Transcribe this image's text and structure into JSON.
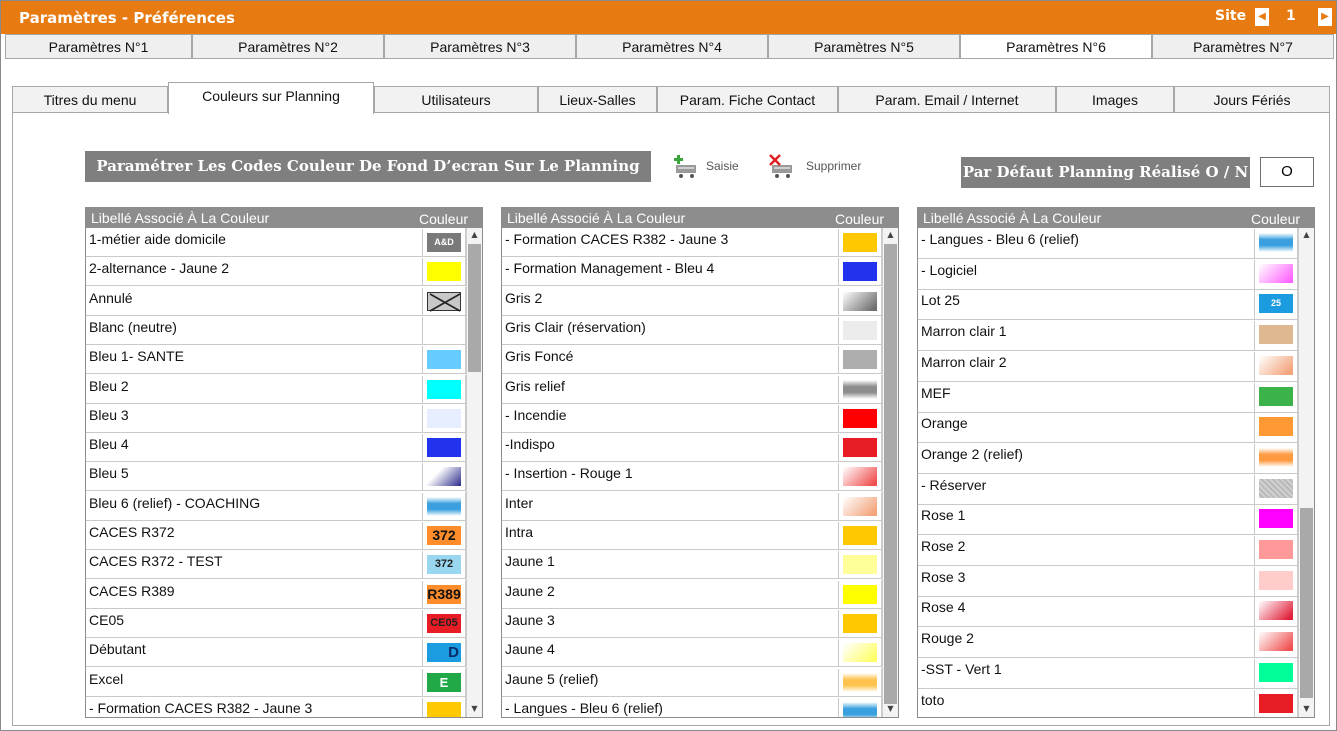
{
  "title": "Paramètres - Préférences",
  "site": {
    "label": "Site",
    "value": "1",
    "prev": "◀",
    "next": "▶"
  },
  "main_tabs": [
    "Paramètres N°1",
    "Paramètres N°2",
    "Paramètres N°3",
    "Paramètres N°4",
    "Paramètres N°5",
    "Paramètres N°6",
    "Paramètres N°7"
  ],
  "main_tab_active": 5,
  "sub_tabs": [
    "Titres du menu",
    "Couleurs sur Planning",
    "Utilisateurs",
    "Lieux-Salles",
    "Param. Fiche Contact",
    "Param. Email / Internet",
    "Images",
    "Jours Fériés"
  ],
  "sub_tab_active": 1,
  "header_button": "Paramétrer Les Codes Couleur De Fond D’ecran Sur Le Planning",
  "actions": {
    "saisie": "Saisie",
    "supprimer": "Supprimer"
  },
  "default_label": "Par Défaut Planning Réalisé O / N",
  "default_value": "O",
  "list_header": {
    "label": "Libellé Associé À La Couleur",
    "color": "Couleur"
  },
  "lists": [
    [
      {
        "label": "1-métier aide domicile",
        "color": "#7a7a7a",
        "text": "A&D",
        "style": "text-light"
      },
      {
        "label": "2-alternance - Jaune 2",
        "color": "#ffff00"
      },
      {
        "label": "Annulé",
        "color": "#c8c8c8",
        "style": "cross"
      },
      {
        "label": "Blanc (neutre)",
        "color": "#ffffff"
      },
      {
        "label": "Bleu 1- SANTE",
        "color": "#66ccff"
      },
      {
        "label": "Bleu 2",
        "color": "#00ffff"
      },
      {
        "label": "Bleu 3",
        "color": "#e6eeff"
      },
      {
        "label": "Bleu 4",
        "color": "#2233ee"
      },
      {
        "label": "Bleu 5",
        "color": "#2b2b8c",
        "style": "fade"
      },
      {
        "label": "Bleu 6 (relief) - COACHING",
        "color": "#3aa0e0",
        "style": "relief"
      },
      {
        "label": "CACES R372",
        "color": "#ff8c2a",
        "text": "372",
        "style": "big"
      },
      {
        "label": "CACES R372 - TEST",
        "color": "#99d6f0",
        "text": "372"
      },
      {
        "label": "CACES R389",
        "color": "#ff8c2a",
        "text": "R389",
        "style": "big"
      },
      {
        "label": "CE05",
        "color": "#e81c24",
        "text": "CE05"
      },
      {
        "label": "Débutant",
        "color": "#1b9be0",
        "text": "D",
        "style": "d"
      },
      {
        "label": "Excel",
        "color": "#21a847",
        "text": "E",
        "style": "e"
      },
      {
        "label": "- Formation CACES R382 - Jaune 3",
        "color": "#ffc800"
      }
    ],
    [
      {
        "label": "- Formation CACES R382 - Jaune 3",
        "color": "#ffc800"
      },
      {
        "label": "- Formation Management - Bleu 4",
        "color": "#2233ee"
      },
      {
        "label": "Gris 2",
        "color": "#6e6e6e",
        "style": "grad"
      },
      {
        "label": "Gris Clair (réservation)",
        "color": "#ececec"
      },
      {
        "label": "Gris Foncé",
        "color": "#aeaeae"
      },
      {
        "label": "Gris relief",
        "color": "#8c8c8c",
        "style": "relief"
      },
      {
        "label": "- Incendie",
        "color": "#ff0000"
      },
      {
        "label": "-Indispo",
        "color": "#e81c24"
      },
      {
        "label": "- Insertion - Rouge 1",
        "color": "#f05050",
        "style": "grad"
      },
      {
        "label": "Inter",
        "color": "#f3a37a",
        "style": "grad"
      },
      {
        "label": "Intra",
        "color": "#ffc800"
      },
      {
        "label": "Jaune 1",
        "color": "#ffff99"
      },
      {
        "label": "Jaune 2",
        "color": "#ffff00"
      },
      {
        "label": "Jaune 3",
        "color": "#ffc800"
      },
      {
        "label": "Jaune 4",
        "color": "#ffff66",
        "style": "grad"
      },
      {
        "label": "Jaune 5 (relief)",
        "color": "#ffc34d",
        "style": "relief"
      },
      {
        "label": "- Langues - Bleu 6 (relief)",
        "color": "#3aa0e0",
        "style": "relief"
      }
    ],
    [
      {
        "label": "- Langues - Bleu 6 (relief)",
        "color": "#3aa0e0",
        "style": "relief"
      },
      {
        "label": "- Logiciel",
        "color": "#ff66ff",
        "style": "grad"
      },
      {
        "label": "Lot 25",
        "color": "#1b9be0",
        "text": "25",
        "style": "text-light"
      },
      {
        "label": "Marron clair 1",
        "color": "#dfb791"
      },
      {
        "label": "Marron clair 2",
        "color": "#f3a37a",
        "style": "grad"
      },
      {
        "label": "MEF",
        "color": "#3cb34a"
      },
      {
        "label": "Orange",
        "color": "#ff9933"
      },
      {
        "label": "Orange 2  (relief)",
        "color": "#ff9a40",
        "style": "relief"
      },
      {
        "label": "- Réserver",
        "color": "#c4c4c4",
        "style": "noise"
      },
      {
        "label": "Rose 1",
        "color": "#ff00ff"
      },
      {
        "label": "Rose 2",
        "color": "#ff9999"
      },
      {
        "label": "Rose 3",
        "color": "#ffcccc"
      },
      {
        "label": "Rose 4",
        "color": "#e0203a",
        "style": "grad"
      },
      {
        "label": "Rouge 2",
        "color": "#f05050",
        "style": "grad"
      },
      {
        "label": "-SST - Vert 1",
        "color": "#00ff99"
      },
      {
        "label": "toto",
        "color": "#e81c24"
      }
    ]
  ]
}
